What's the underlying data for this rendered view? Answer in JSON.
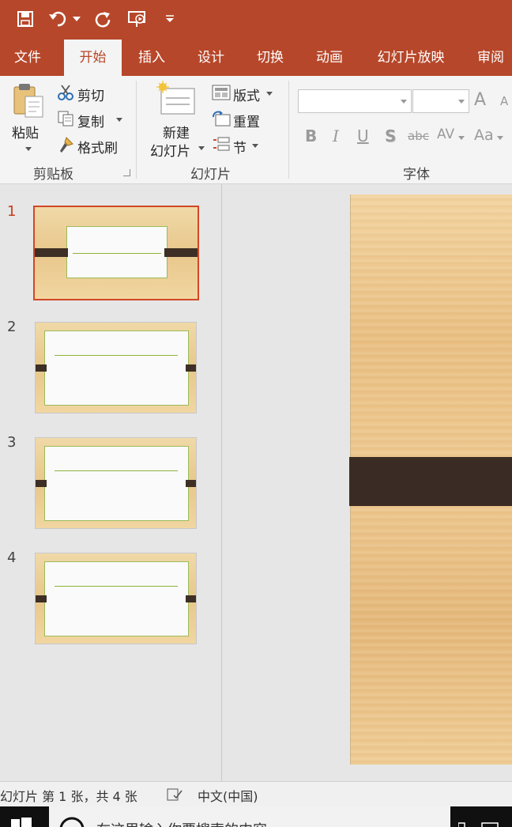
{
  "qat": {
    "save_icon": "save-icon",
    "undo_icon": "undo-icon",
    "redo_icon": "redo-icon",
    "present_icon": "present-from-start-icon",
    "customize_icon": "customize-qat-icon"
  },
  "tabs": [
    "文件",
    "开始",
    "插入",
    "设计",
    "切换",
    "动画",
    "幻灯片放映",
    "审阅"
  ],
  "active_tab": "开始",
  "ribbon": {
    "clipboard": {
      "paste": "粘贴",
      "cut": "剪切",
      "copy": "复制",
      "format_painter": "格式刷",
      "group": "剪贴板"
    },
    "slides": {
      "new_slide_line1": "新建",
      "new_slide_line2": "幻灯片",
      "layout": "版式",
      "reset": "重置",
      "section": "节",
      "group": "幻灯片"
    },
    "font": {
      "bold": "B",
      "italic": "I",
      "underline": "U",
      "shadow": "S",
      "strike": "abc",
      "spacing": "AV",
      "case": "Aa",
      "grow": "A",
      "shrink": "A",
      "group": "字体"
    }
  },
  "slides": [
    {
      "number": "1",
      "selected": true
    },
    {
      "number": "2",
      "selected": false
    },
    {
      "number": "3",
      "selected": false
    },
    {
      "number": "4",
      "selected": false
    }
  ],
  "status": {
    "slide_info": "幻灯片 第 1 张，共 4 张",
    "language": "中文(中国)"
  },
  "taskbar": {
    "search_text": "在这里输入你要搜索的内容"
  },
  "colors": {
    "accent": "#b7472a",
    "selection": "#d24726",
    "wood": "#e9c387",
    "band": "#3a2c24"
  }
}
